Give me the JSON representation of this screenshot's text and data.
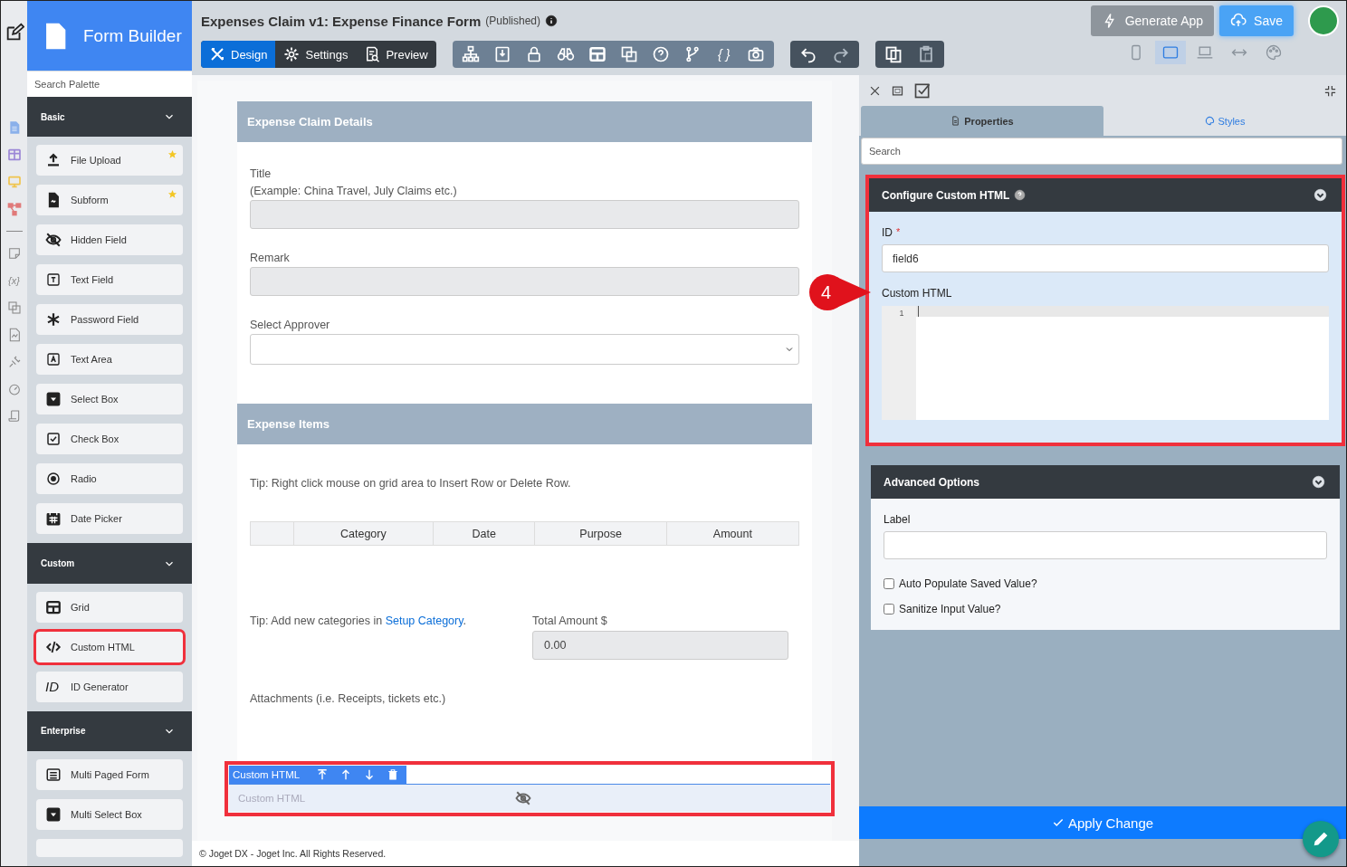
{
  "rail": {
    "variable_glyph": "{x}"
  },
  "palette": {
    "title": "Form Builder",
    "search": {
      "placeholder": "Search Palette"
    },
    "sections": [
      {
        "title": "Basic",
        "expanded": true,
        "items": [
          {
            "label": "File Upload",
            "starred": true,
            "highlighted": false
          },
          {
            "label": "Subform",
            "starred": true,
            "highlighted": false
          },
          {
            "label": "Hidden Field",
            "starred": false,
            "highlighted": false
          },
          {
            "label": "Text Field",
            "starred": false,
            "highlighted": false
          },
          {
            "label": "Password Field",
            "starred": false,
            "highlighted": false
          },
          {
            "label": "Text Area",
            "starred": false,
            "highlighted": false
          },
          {
            "label": "Select Box",
            "starred": false,
            "highlighted": false
          },
          {
            "label": "Check Box",
            "starred": false,
            "highlighted": false
          },
          {
            "label": "Radio",
            "starred": false,
            "highlighted": false
          },
          {
            "label": "Date Picker",
            "starred": false,
            "highlighted": false
          }
        ]
      },
      {
        "title": "Custom",
        "expanded": true,
        "items": [
          {
            "label": "Grid",
            "starred": false,
            "highlighted": false
          },
          {
            "label": "Custom HTML",
            "starred": false,
            "highlighted": true
          },
          {
            "label": "ID Generator",
            "glyph": "ID",
            "starred": false,
            "highlighted": false
          }
        ]
      },
      {
        "title": "Enterprise",
        "expanded": true,
        "items": [
          {
            "label": "Multi Paged Form",
            "starred": false,
            "highlighted": false
          },
          {
            "label": "Multi Select Box",
            "starred": false,
            "highlighted": false
          }
        ]
      }
    ]
  },
  "header": {
    "title": "Expenses Claim v1: Expense Finance Form",
    "status": "(Published)",
    "tabs": [
      {
        "label": "Design",
        "selected": true
      },
      {
        "label": "Settings",
        "selected": false
      },
      {
        "label": "Preview",
        "selected": false
      }
    ],
    "braces_glyph": "{ }",
    "buttons": [
      {
        "label": "Generate App",
        "kind": "secondary"
      },
      {
        "label": "Save",
        "kind": "primary"
      }
    ],
    "devices": [
      {
        "selected": false
      },
      {
        "selected": true
      },
      {
        "selected": false
      },
      {
        "selected": false
      },
      {
        "selected": false
      }
    ]
  },
  "form": {
    "sections": [
      {
        "title": "Expense Claim Details"
      },
      {
        "title": "Expense Items"
      }
    ],
    "title_field": {
      "label": "Title",
      "hint": "(Example: China Travel, July Claims etc.)"
    },
    "remark_field": {
      "label": "Remark"
    },
    "approver_field": {
      "label": "Select Approver"
    },
    "grid_tip": "Tip: Right click mouse on grid area to Insert Row or Delete Row.",
    "grid_columns": [
      "Category",
      "Date",
      "Purpose",
      "Amount"
    ],
    "category_tip": {
      "text": "Tip: Add new categories in ",
      "link": "Setup Category",
      "end": "."
    },
    "total": {
      "label": "Total Amount $",
      "value": "0.00"
    },
    "attachments": {
      "label": "Attachments (i.e. Receipts, tickets etc.)"
    },
    "selected_element": {
      "label": "Custom HTML",
      "placeholder": "Custom HTML",
      "highlighted": true
    }
  },
  "footer": "© Joget DX - Joget Inc. All Rights Reserved.",
  "properties": {
    "tabs": [
      {
        "label": "Properties",
        "selected": true
      },
      {
        "label": "Styles",
        "selected": false
      }
    ],
    "search": {
      "placeholder": "Search"
    },
    "panels": [
      {
        "kind": "configure",
        "title": "Configure Custom HTML",
        "highlighted": true,
        "id_label": "ID",
        "required_mark": "*",
        "id_value": "field6",
        "html_label": "Custom HTML",
        "line_number": "1"
      },
      {
        "kind": "advanced",
        "title": "Advanced Options",
        "highlighted": false,
        "label_label": "Label",
        "checkboxes": [
          {
            "label": "Auto Populate Saved Value?",
            "checked": false
          },
          {
            "label": "Sanitize Input Value?",
            "checked": false
          }
        ]
      }
    ],
    "apply": "Apply Change"
  },
  "callout": {
    "number": "4"
  }
}
